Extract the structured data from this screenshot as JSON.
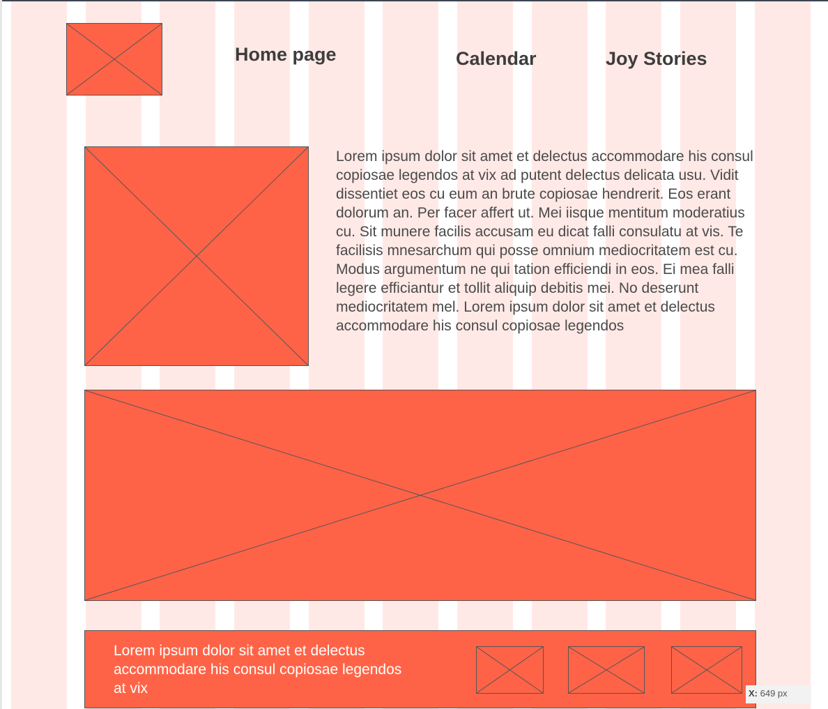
{
  "nav": {
    "home": "Home page",
    "calendar": "Calendar",
    "stories": "Joy Stories"
  },
  "intro": {
    "text": "Lorem ipsum dolor sit amet et delectus accommodare his consul copiosae legendos at vix ad putent delectus delicata usu. Vidit dissentiet eos cu eum an brute copiosae hendrerit. Eos erant dolorum an. Per facer affert ut. Mei iisque mentitum moderatius cu. Sit munere facilis accusam eu dicat falli consulatu at vis. Te facilisis mnesarchum qui posse omnium mediocritatem est cu. Modus argumentum ne qui tation efficiendi in eos. Ei mea falli legere efficiantur et tollit aliquip debitis mei. No deserunt mediocritatem mel. Lorem ipsum dolor sit amet et delectus accommodare his consul copiosae legendos"
  },
  "footer": {
    "text": "Lorem ipsum dolor sit amet et delectus accommodare his consul copiosae legendos at vix"
  },
  "cursor_readout": {
    "label": "X:",
    "value": "649 px"
  },
  "colors": {
    "placeholder_fill": "#ff6347",
    "grid_column": "#ffe9e6",
    "outline": "#555555"
  }
}
